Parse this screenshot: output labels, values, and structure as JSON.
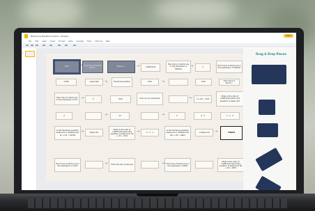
{
  "app": {
    "doc_title": "Balancing Equations Game - Escape",
    "share_label": "Share",
    "menus": [
      "File",
      "Edit",
      "View",
      "Insert",
      "Format",
      "Slide",
      "Arrange",
      "Tools",
      "Add-ons",
      "Help"
    ]
  },
  "filmstrip": {
    "slide_number": "1"
  },
  "sidebar": {
    "title": "Drag & Drop Pieces"
  },
  "board": {
    "row1": [
      "Start",
      "How many H atoms are in...",
      "Balance...",
      "coefficients",
      "How many O atoms are in the expression 2 H2SO4?",
      "2",
      "How many O atoms are in the expression 3 H2SO4?"
    ],
    "row2": [
      "C2H6",
      "subscripts",
      "Chemical equation",
      "H2O",
      "",
      "H2O",
      "How many O atoms..."
    ],
    "row3": [
      "How many H atoms are in the expression 3 H2?",
      "6",
      "H2O",
      "How do you symbolize",
      "",
      "What is the ratio of coefficients when this equation is balanced?",
      "3 + O2 → SO3"
    ],
    "row4": [
      "3",
      "",
      "12",
      "",
      "2",
      "4 : 3",
      "1 : 1 : 2"
    ],
    "row5": [
      "Is the following equation balanced or unbalanced? Fe + O2 → Fe2O3",
      "Balanced",
      "What is the ratio of coefficients when this equation is balanced? H2 + O2 → H2O",
      "2 : 1 : 1",
      "Is the following equation balanced or unbalanced? Na + Cl2 → NaCl",
      "unbalanced",
      "FINISH"
    ],
    "row6": [
      "How many O atoms are in the expression 2 CO2?",
      "",
      "Show the two molecules",
      "",
      "How many H atoms are in the expression 2 NH3?",
      "",
      "What is the ratio of coefficients when this equation is balanced? N2 + H2 → NH3"
    ]
  }
}
